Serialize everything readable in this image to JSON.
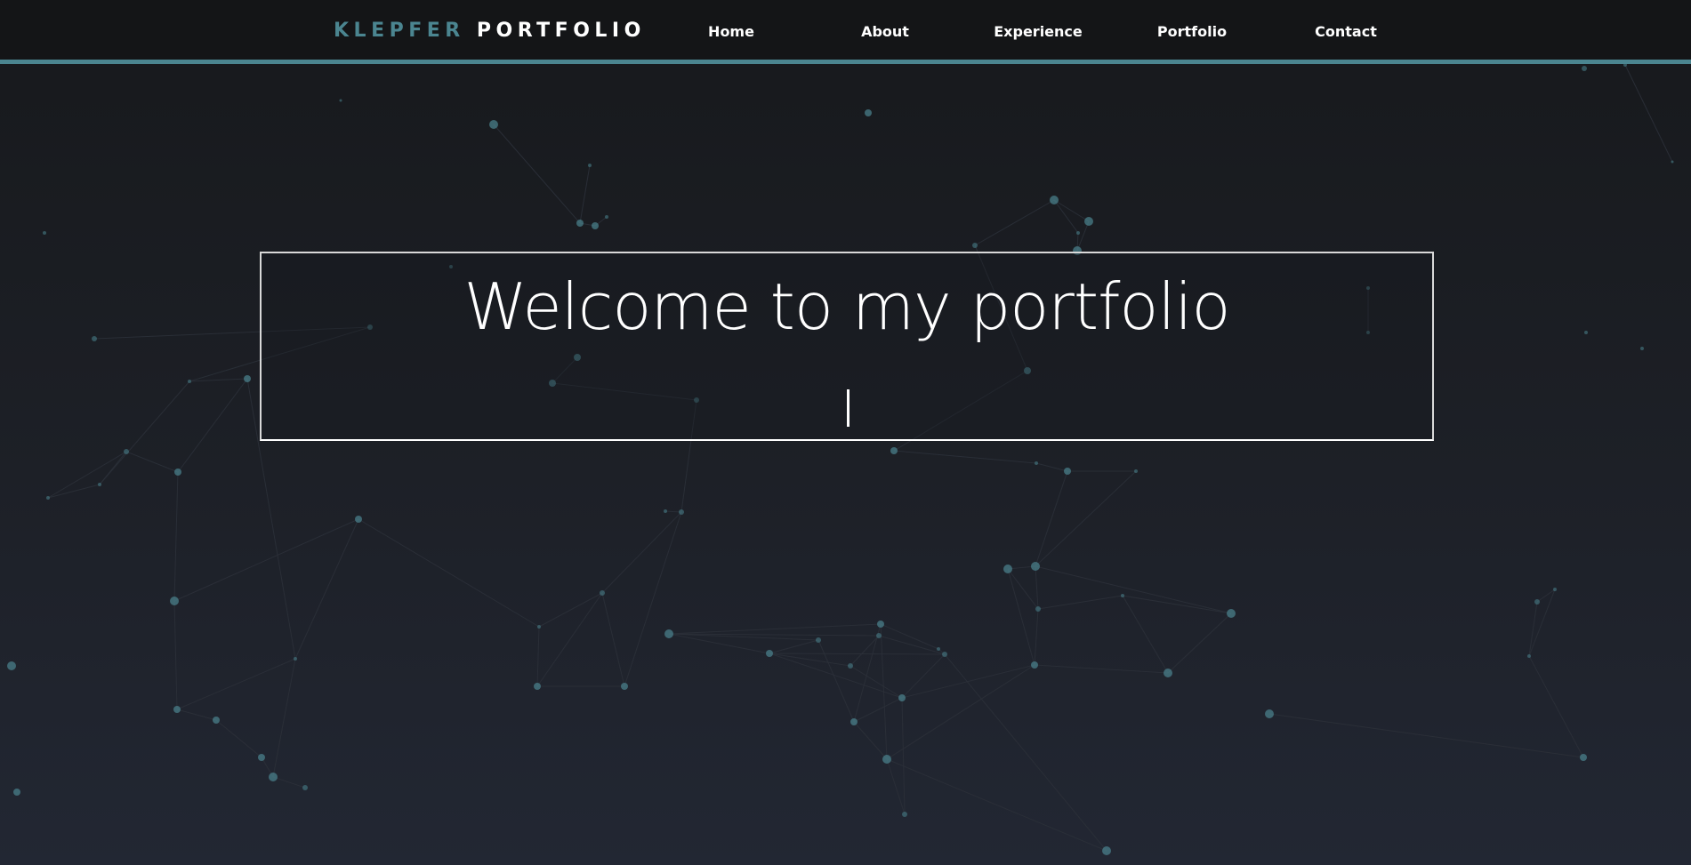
{
  "header": {
    "brand_first": "KLEPFER",
    "brand_second": "PORTFOLIO",
    "nav": [
      {
        "label": "Home"
      },
      {
        "label": "About"
      },
      {
        "label": "Experience"
      },
      {
        "label": "Portfolio"
      },
      {
        "label": "Contact"
      }
    ]
  },
  "hero": {
    "title": "Welcome to my portfolio",
    "typed_text": ""
  },
  "colors": {
    "accent": "#4b8590",
    "header_bg": "#141517",
    "page_bg_top": "#17191c",
    "page_bg_bottom": "#222733",
    "text": "#ffffff"
  }
}
